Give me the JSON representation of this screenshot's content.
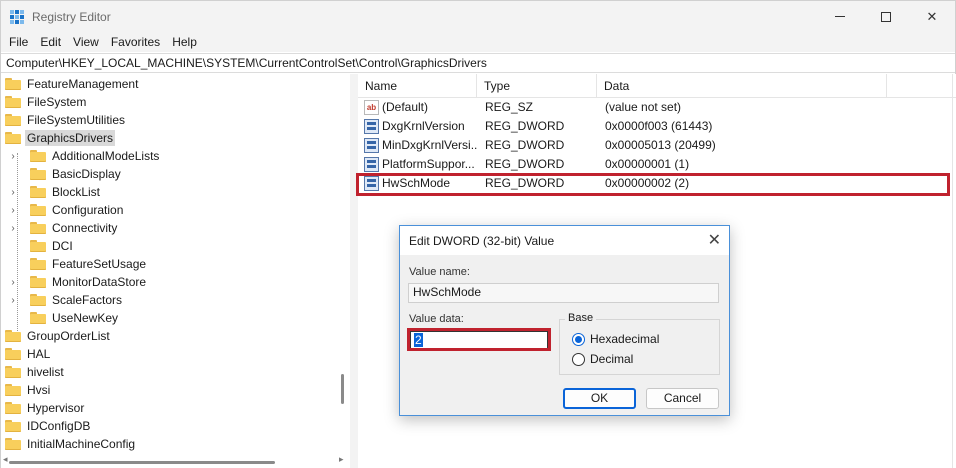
{
  "window": {
    "title": "Registry Editor",
    "controls": {
      "minimize": "",
      "maximize": "",
      "close": "✕"
    }
  },
  "menu": [
    "File",
    "Edit",
    "View",
    "Favorites",
    "Help"
  ],
  "address": "Computer\\HKEY_LOCAL_MACHINE\\SYSTEM\\CurrentControlSet\\Control\\GraphicsDrivers",
  "tree": {
    "items": [
      {
        "label": "FeatureManagement",
        "level": 0,
        "expandable": false,
        "selected": false
      },
      {
        "label": "FileSystem",
        "level": 0,
        "expandable": false,
        "selected": false
      },
      {
        "label": "FileSystemUtilities",
        "level": 0,
        "expandable": false,
        "selected": false
      },
      {
        "label": "GraphicsDrivers",
        "level": 0,
        "expandable": false,
        "selected": true
      },
      {
        "label": "AdditionalModeLists",
        "level": 1,
        "expandable": true,
        "selected": false
      },
      {
        "label": "BasicDisplay",
        "level": 1,
        "expandable": false,
        "selected": false
      },
      {
        "label": "BlockList",
        "level": 1,
        "expandable": true,
        "selected": false
      },
      {
        "label": "Configuration",
        "level": 1,
        "expandable": true,
        "selected": false
      },
      {
        "label": "Connectivity",
        "level": 1,
        "expandable": true,
        "selected": false
      },
      {
        "label": "DCI",
        "level": 1,
        "expandable": false,
        "selected": false
      },
      {
        "label": "FeatureSetUsage",
        "level": 1,
        "expandable": false,
        "selected": false
      },
      {
        "label": "MonitorDataStore",
        "level": 1,
        "expandable": true,
        "selected": false
      },
      {
        "label": "ScaleFactors",
        "level": 1,
        "expandable": true,
        "selected": false
      },
      {
        "label": "UseNewKey",
        "level": 1,
        "expandable": false,
        "selected": false
      },
      {
        "label": "GroupOrderList",
        "level": 0,
        "expandable": false,
        "selected": false
      },
      {
        "label": "HAL",
        "level": 0,
        "expandable": false,
        "selected": false
      },
      {
        "label": "hivelist",
        "level": 0,
        "expandable": false,
        "selected": false
      },
      {
        "label": "Hvsi",
        "level": 0,
        "expandable": false,
        "selected": false
      },
      {
        "label": "Hypervisor",
        "level": 0,
        "expandable": false,
        "selected": false
      },
      {
        "label": "IDConfigDB",
        "level": 0,
        "expandable": false,
        "selected": false
      },
      {
        "label": "InitialMachineConfig",
        "level": 0,
        "expandable": false,
        "selected": false
      }
    ]
  },
  "list": {
    "columns": [
      "Name",
      "Type",
      "Data"
    ],
    "rows": [
      {
        "icon": "string-value-icon",
        "icon_text": "ab",
        "name": "(Default)",
        "type": "REG_SZ",
        "data": "(value not set)"
      },
      {
        "icon": "binary-value-icon",
        "icon_text": "",
        "name": "DxgKrnlVersion",
        "type": "REG_DWORD",
        "data": "0x0000f003 (61443)"
      },
      {
        "icon": "binary-value-icon",
        "icon_text": "",
        "name": "MinDxgKrnlVersi...",
        "type": "REG_DWORD",
        "data": "0x00005013 (20499)"
      },
      {
        "icon": "binary-value-icon",
        "icon_text": "",
        "name": "PlatformSuppor...",
        "type": "REG_DWORD",
        "data": "0x00000001 (1)"
      },
      {
        "icon": "binary-value-icon",
        "icon_text": "",
        "name": "HwSchMode",
        "type": "REG_DWORD",
        "data": "0x00000002 (2)"
      }
    ]
  },
  "dialog": {
    "title": "Edit DWORD (32-bit) Value",
    "close": "✕",
    "value_name_label": "Value name:",
    "value_name": "HwSchMode",
    "value_data_label": "Value data:",
    "value_data": "2",
    "base_label": "Base",
    "base_options": [
      {
        "label": "Hexadecimal",
        "checked": true
      },
      {
        "label": "Decimal",
        "checked": false
      }
    ],
    "ok_label": "OK",
    "cancel_label": "Cancel"
  },
  "colors": {
    "highlight": "#c0222e",
    "accent": "#0a64d8",
    "folder": "#f8cf5c"
  }
}
